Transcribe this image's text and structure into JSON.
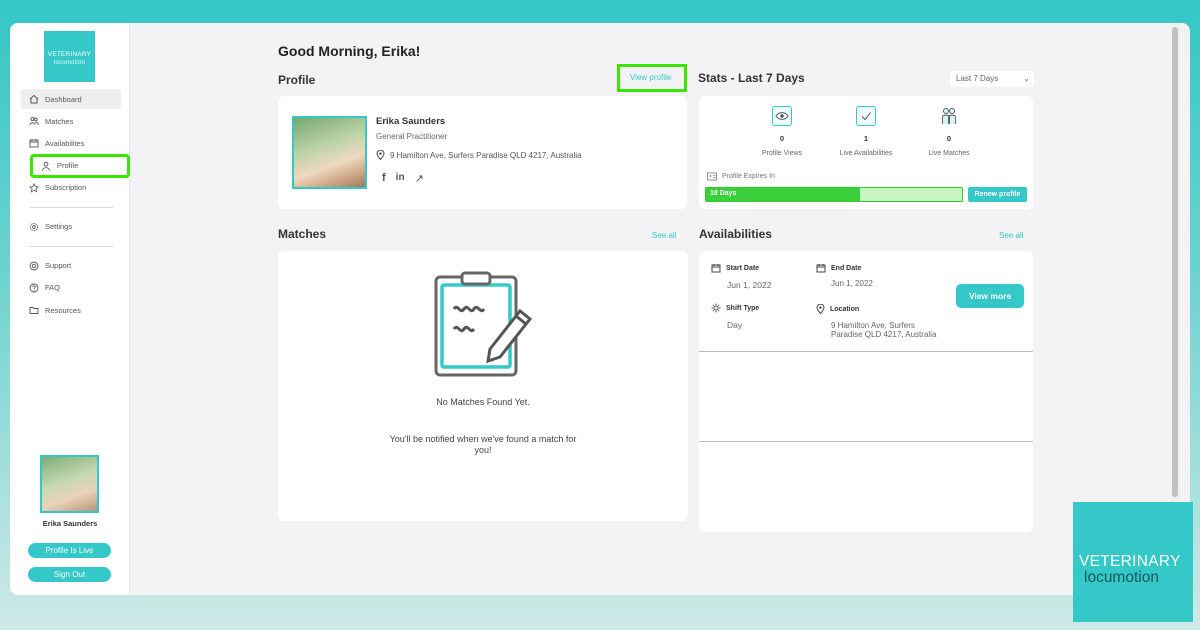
{
  "logo": {
    "line1": "VETERINARY",
    "line2": "locumotion"
  },
  "sidebar": {
    "items": [
      {
        "label": "Dashboard",
        "icon": "home-icon"
      },
      {
        "label": "Matches",
        "icon": "users-icon"
      },
      {
        "label": "Availabilites",
        "icon": "calendar-icon"
      },
      {
        "label": "Profile",
        "icon": "user-icon"
      },
      {
        "label": "Subscription",
        "icon": "star-icon"
      },
      {
        "label": "Settings",
        "icon": "gear-icon"
      },
      {
        "label": "Support",
        "icon": "support-icon"
      },
      {
        "label": "FAQ",
        "icon": "help-icon"
      },
      {
        "label": "Resources",
        "icon": "folder-icon"
      }
    ],
    "user_name": "Erika Saunders",
    "live_button": "Profile Is Live",
    "signout_button": "Sign Out"
  },
  "greeting": "Good Morning, Erika!",
  "profile": {
    "title": "Profile",
    "view_link": "View profile",
    "name": "Erika Saunders",
    "role": "General Practitioner",
    "location": "9 Hamilton Ave, Surfers Paradise QLD 4217, Australia",
    "social": {
      "facebook": "f",
      "linkedin": "in",
      "external": "↗"
    }
  },
  "stats": {
    "title": "Stats - Last 7 Days",
    "range": "Last 7 Days",
    "items": [
      {
        "label": "Profile Views",
        "value": "0"
      },
      {
        "label": "Live Availabilities",
        "value": "1"
      },
      {
        "label": "Live Matches",
        "value": "0"
      }
    ],
    "expires_label": "Profile Expires In",
    "expires_value": "18 Days",
    "expires_progress": 0.6,
    "renew_button": "Renew profile"
  },
  "matches": {
    "title": "Matches",
    "see_all": "See all",
    "empty_title": "No Matches Found Yet.",
    "empty_line1": "You'll be notified when we've found a match for",
    "empty_line2": "you!"
  },
  "availabilities": {
    "title": "Availabilities",
    "see_all": "See all",
    "start_label": "Start Date",
    "start_value": "Jun 1, 2022",
    "end_label": "End Date",
    "end_value": "Jun 1, 2022",
    "shift_label": "Shift Type",
    "shift_value": "Day",
    "location_label": "Location",
    "location_line1": "9 Hamilton Ave, Surfers",
    "location_line2": "Paradise QLD 4217, Australia",
    "view_more": "View more"
  },
  "brand": {
    "line1": "VETERINARY",
    "line2": "locumotion"
  },
  "colors": {
    "accent": "#35c8c8",
    "highlight": "#39e600",
    "progress": "#3bcf3b"
  }
}
